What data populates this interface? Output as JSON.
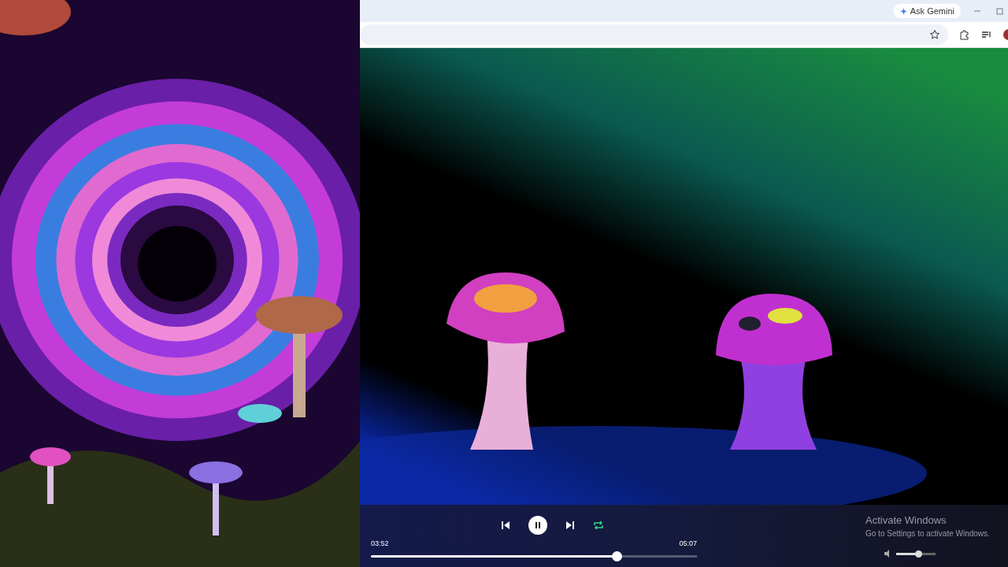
{
  "browser": {
    "ask_button": "Ask Gemini"
  },
  "controls": {
    "playing": true,
    "repeat_on": true,
    "elapsed": "03:52",
    "duration": "05:07",
    "progress": {
      "level": 0.753
    },
    "volume": {
      "level": 0.55
    }
  },
  "os_notice": {
    "title": "Activate Windows",
    "message": "Go to Settings to activate Windows."
  }
}
